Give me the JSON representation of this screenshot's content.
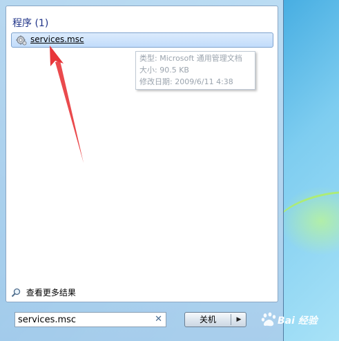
{
  "start_menu": {
    "section_header": "程序 (1)",
    "result": {
      "label": "services.msc",
      "icon": "services-gear-icon"
    },
    "tooltip": {
      "type_line": "类型: Microsoft 通用管理文档",
      "size_line": "大小: 90.5 KB",
      "modified_line": "修改日期: 2009/6/11 4:38"
    },
    "see_more": {
      "label": "查看更多结果",
      "icon": "search-icon"
    },
    "search": {
      "value": "services.msc",
      "clear_glyph": "✕"
    },
    "shutdown": {
      "label": "关机",
      "dropdown_glyph": "▶"
    }
  },
  "watermark": {
    "text": "Bai 经验"
  },
  "colors": {
    "selection_fill": "#c1dcfb",
    "selection_border": "#7da2ce",
    "header_text": "#1e3287",
    "annotation_arrow": "#e8363a"
  }
}
